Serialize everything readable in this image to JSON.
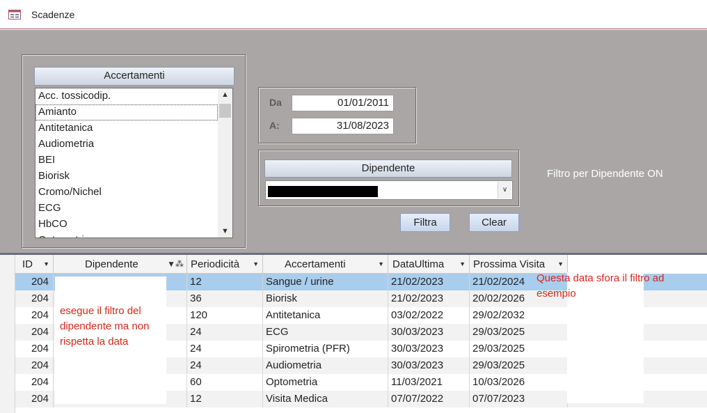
{
  "window": {
    "title": "Scadenze"
  },
  "accertamenti_list": {
    "header": "Accertamenti",
    "items": [
      "Acc. tossicodip.",
      "Amianto",
      "Antitetanica",
      "Audiometria",
      "BEI",
      "Biorisk",
      "Cromo/Nichel",
      "ECG",
      "HbCO",
      "Optometria"
    ],
    "selected_index": 1
  },
  "date_filter": {
    "from_label": "Da",
    "from_value": "01/01/2011",
    "to_label": "A:",
    "to_value": "31/08/2023"
  },
  "dipendente": {
    "header": "Dipendente"
  },
  "buttons": {
    "filter": "Filtra",
    "clear": "Clear"
  },
  "status_text": "Filtro per Dipendente ON",
  "table": {
    "columns": [
      "ID",
      "Dipendente",
      "Periodicità",
      "Accertamenti",
      "DataUltima",
      "Prossima Visita"
    ],
    "rows": [
      [
        "204",
        "",
        "12",
        "Sangue / urine",
        "21/02/2023",
        "21/02/2024"
      ],
      [
        "204",
        "",
        "36",
        "Biorisk",
        "21/02/2023",
        "20/02/2026"
      ],
      [
        "204",
        "",
        "120",
        "Antitetanica",
        "03/02/2022",
        "29/02/2032"
      ],
      [
        "204",
        "",
        "24",
        "ECG",
        "30/03/2023",
        "29/03/2025"
      ],
      [
        "204",
        "",
        "24",
        "Spirometria (PFR)",
        "30/03/2023",
        "29/03/2025"
      ],
      [
        "204",
        "",
        "24",
        "Audiometria",
        "30/03/2023",
        "29/03/2025"
      ],
      [
        "204",
        "",
        "60",
        "Optometria",
        "11/03/2021",
        "10/03/2026"
      ],
      [
        "204",
        "",
        "12",
        "Visita Medica",
        "07/07/2022",
        "07/07/2023"
      ]
    ],
    "selected_row": 0
  },
  "annotations": {
    "left_note": "esegue il filtro del dipendente ma non rispetta la data",
    "right_note": "Questa data sfora il filtro ad esempio"
  },
  "colors": {
    "form_bg": "#aaa6a6",
    "selected_row": "#a9cdec",
    "annotation": "#d9261c",
    "title_border": "#b3525f"
  }
}
